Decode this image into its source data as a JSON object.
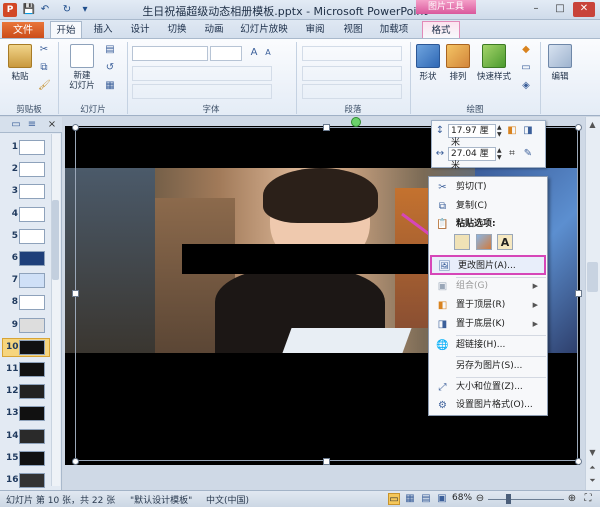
{
  "window": {
    "title": "生日祝福超级动态相册模板.pptx - Microsoft PowerPoint",
    "app_icon": "P",
    "context_group": "图片工具",
    "controls": [
      "–",
      "□",
      "✕"
    ]
  },
  "qat": {
    "save_icon": "💾",
    "undo_icon": "↶",
    "redo_icon": "↻",
    "more_icon": "▾"
  },
  "tabs": {
    "file": "文件",
    "items": [
      "开始",
      "插入",
      "设计",
      "切换",
      "动画",
      "幻灯片放映",
      "审阅",
      "视图",
      "加载项",
      "格式"
    ]
  },
  "ribbon": {
    "paste": "粘贴",
    "new_slide": "新建\n幻灯片",
    "groups": [
      "剪贴板",
      "幻灯片",
      "字体",
      "段落",
      "绘图"
    ],
    "shape": "形状",
    "arrange": "排列",
    "quick_styles": "快速样式",
    "edit": "编辑"
  },
  "thumbnails": [
    {
      "num": "1"
    },
    {
      "num": "2"
    },
    {
      "num": "3"
    },
    {
      "num": "4"
    },
    {
      "num": "5"
    },
    {
      "num": "6"
    },
    {
      "num": "7"
    },
    {
      "num": "8"
    },
    {
      "num": "9"
    },
    {
      "num": "10"
    },
    {
      "num": "11"
    },
    {
      "num": "12"
    },
    {
      "num": "13"
    },
    {
      "num": "14"
    },
    {
      "num": "15"
    },
    {
      "num": "16"
    }
  ],
  "size_toolbar": {
    "height": "17.97 厘米",
    "width": "27.04 厘米"
  },
  "context_menu": {
    "cut": "剪切(T)",
    "copy": "复制(C)",
    "paste_options": "粘贴选项:",
    "change_picture": "更改图片(A)...",
    "group": "组合(G)",
    "bring_front": "置于顶层(R)",
    "send_back": "置于底层(K)",
    "hyperlink": "超链接(H)...",
    "save_as_picture": "另存为图片(S)...",
    "size_position": "大小和位置(Z)...",
    "format_picture": "设置图片格式(O)..."
  },
  "status": {
    "slide_info": "幻灯片 第 10 张，共 22 张",
    "theme": "\"默认设计模板\"",
    "language": "中文(中国)",
    "zoom": "68%"
  },
  "colors": {
    "accent": "#d24726",
    "highlight": "#d646b8"
  }
}
